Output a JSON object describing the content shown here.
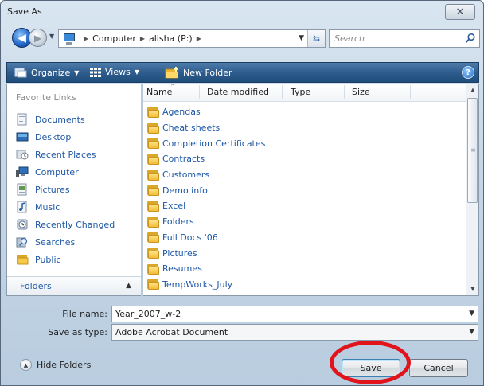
{
  "window": {
    "title": "Save As",
    "close_symbol": "✕"
  },
  "navigation": {
    "back_icon": "back-arrow-icon",
    "forward_icon": "forward-arrow-icon",
    "breadcrumbs": [
      "Computer",
      "alisha (P:)"
    ],
    "search_placeholder": "Search"
  },
  "toolbar": {
    "organize_label": "Organize",
    "views_label": "Views",
    "new_folder_label": "New Folder",
    "help_symbol": "?"
  },
  "sidebar": {
    "title": "Favorite Links",
    "items": [
      {
        "label": "Documents",
        "icon": "documents-icon"
      },
      {
        "label": "Desktop",
        "icon": "desktop-icon"
      },
      {
        "label": "Recent Places",
        "icon": "recent-places-icon"
      },
      {
        "label": "Computer",
        "icon": "computer-icon"
      },
      {
        "label": "Pictures",
        "icon": "pictures-icon"
      },
      {
        "label": "Music",
        "icon": "music-icon"
      },
      {
        "label": "Recently Changed",
        "icon": "recently-changed-icon"
      },
      {
        "label": "Searches",
        "icon": "searches-icon"
      },
      {
        "label": "Public",
        "icon": "public-folder-icon"
      }
    ],
    "folders_label": "Folders"
  },
  "file_list": {
    "columns": [
      "Name",
      "Date modified",
      "Type",
      "Size"
    ],
    "rows": [
      "Agendas",
      "Cheat sheets",
      "Completion Certificates",
      "Contracts",
      "Customers",
      "Demo info",
      "Excel",
      "Folders",
      "Full Docs '06",
      "Pictures",
      "Resumes",
      "TempWorks_July"
    ]
  },
  "form": {
    "file_name_label": "File name:",
    "file_name_value": "Year_2007_w-2",
    "save_type_label": "Save as type:",
    "save_type_value": "Adobe Acrobat Document"
  },
  "footer": {
    "hide_folders_label": "Hide Folders",
    "save_label": "Save",
    "cancel_label": "Cancel"
  },
  "colors": {
    "toolbar": "#2e5d8e",
    "link": "#1e57a6",
    "highlight_ring": "#e0141a"
  }
}
